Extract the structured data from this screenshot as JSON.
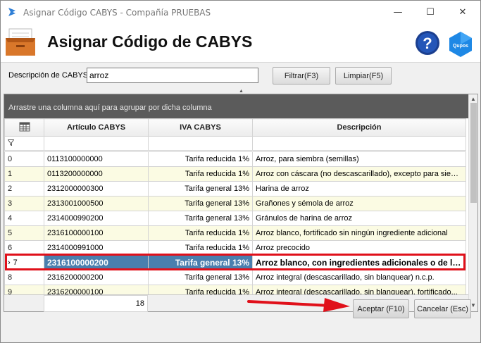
{
  "window": {
    "title": "Asignar Código CABYS - Compañía PRUEBAS",
    "minimize": "—",
    "maximize": "☐",
    "close": "✕"
  },
  "header": {
    "title": "Asignar Código de CABYS",
    "help_glyph": "?",
    "brand_text": "Qupos"
  },
  "search": {
    "label": "Descripción de CABYS:",
    "value": "arroz",
    "filter_button": "Filtrar(F3)",
    "clear_button": "Limpiar(F5)"
  },
  "grid": {
    "group_panel_text": "Arrastre una columna aquí para agrupar por dicha columna",
    "columns": [
      "Artículo CABYS",
      "IVA CABYS",
      "Descripción"
    ],
    "rows": [
      {
        "index": "0",
        "code": "0113100000000",
        "iva": "Tarifa reducida 1%",
        "desc": "Arroz, para siembra (semillas)"
      },
      {
        "index": "1",
        "code": "0113200000000",
        "iva": "Tarifa reducida 1%",
        "desc": "Arroz con cáscara (no descascarillado), excepto para siem..."
      },
      {
        "index": "2",
        "code": "2312000000300",
        "iva": "Tarifa general 13%",
        "desc": "Harina de arroz"
      },
      {
        "index": "3",
        "code": "2313001000500",
        "iva": "Tarifa general 13%",
        "desc": "Grañones y sémola de arroz"
      },
      {
        "index": "4",
        "code": "2314000990200",
        "iva": "Tarifa general 13%",
        "desc": "Gránulos de harina de arroz"
      },
      {
        "index": "5",
        "code": "2316100000100",
        "iva": "Tarifa reducida 1%",
        "desc": "Arroz blanco, fortificado sin ningún ingrediente adicional"
      },
      {
        "index": "6",
        "code": "2314000991000",
        "iva": "Tarifa reducida 1%",
        "desc": "Arroz precocido"
      },
      {
        "index": "7",
        "code": "2316100000200",
        "iva": "Tarifa general 13%",
        "desc": "Arroz blanco, con ingredientes adicionales o de los..."
      },
      {
        "index": "8",
        "code": "2316200000200",
        "iva": "Tarifa general 13%",
        "desc": "Arroz integral (descascarillado, sin blanquear) n.c.p."
      },
      {
        "index": "9",
        "code": "2316200000100",
        "iva": "Tarifa reducida 1%",
        "desc": "Arroz integral (descascarillado, sin blanquear), fortificado..."
      }
    ],
    "selected_index": 7,
    "selected_marker": "›",
    "row_count": "18"
  },
  "footer": {
    "accept_button": "Aceptar (F10)",
    "cancel_button": "Cancelar (Esc)"
  },
  "colors": {
    "selection": "#4a7fae",
    "alt_row": "#fbfbe3",
    "highlight_outline": "#e0101a",
    "brand": "#1e88e5"
  }
}
